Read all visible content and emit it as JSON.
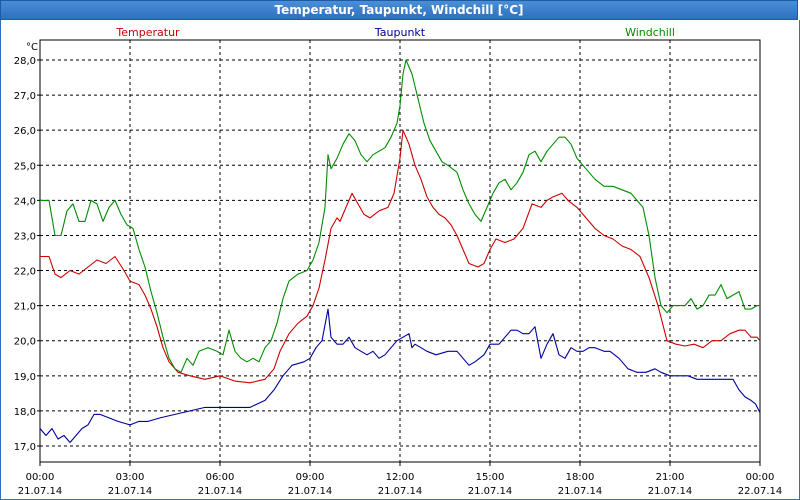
{
  "window": {
    "title": "Temperatur, Taupunkt, Windchill [°C]"
  },
  "chart_data": {
    "type": "line",
    "title": "Temperatur, Taupunkt, Windchill [°C]",
    "ylabel": "°C",
    "ylim": [
      16.6,
      28.5
    ],
    "xlim": [
      0,
      24
    ],
    "yticks": [
      "17,0",
      "18,0",
      "19,0",
      "20,0",
      "21,0",
      "22,0",
      "23,0",
      "24,0",
      "25,0",
      "26,0",
      "27,0",
      "28,0"
    ],
    "ytick_values": [
      17,
      18,
      19,
      20,
      21,
      22,
      23,
      24,
      25,
      26,
      27,
      28
    ],
    "xticks": [
      {
        "time": "00:00",
        "date": "21.07.14"
      },
      {
        "time": "03:00",
        "date": "21.07.14"
      },
      {
        "time": "06:00",
        "date": "21.07.14"
      },
      {
        "time": "09:00",
        "date": "21.07.14"
      },
      {
        "time": "12:00",
        "date": "21.07.14"
      },
      {
        "time": "15:00",
        "date": "21.07.14"
      },
      {
        "time": "18:00",
        "date": "21.07.14"
      },
      {
        "time": "21:00",
        "date": "21.07.14"
      },
      {
        "time": "00:00",
        "date": "22.07.14"
      }
    ],
    "grid": true,
    "series": [
      {
        "name": "Temperatur",
        "color": "#cc0000",
        "points": [
          [
            0,
            22.4
          ],
          [
            0.3,
            22.4
          ],
          [
            0.5,
            21.9
          ],
          [
            0.7,
            21.8
          ],
          [
            1,
            22.0
          ],
          [
            1.3,
            21.9
          ],
          [
            1.6,
            22.1
          ],
          [
            1.9,
            22.3
          ],
          [
            2.2,
            22.2
          ],
          [
            2.5,
            22.4
          ],
          [
            2.8,
            22.0
          ],
          [
            3.0,
            21.7
          ],
          [
            3.3,
            21.6
          ],
          [
            3.5,
            21.3
          ],
          [
            3.7,
            20.9
          ],
          [
            3.9,
            20.4
          ],
          [
            4.1,
            19.8
          ],
          [
            4.3,
            19.4
          ],
          [
            4.6,
            19.1
          ],
          [
            5.0,
            19.0
          ],
          [
            5.5,
            18.9
          ],
          [
            6.0,
            19.0
          ],
          [
            6.5,
            18.85
          ],
          [
            7.0,
            18.8
          ],
          [
            7.5,
            18.9
          ],
          [
            7.8,
            19.2
          ],
          [
            8.0,
            19.7
          ],
          [
            8.3,
            20.2
          ],
          [
            8.6,
            20.5
          ],
          [
            8.9,
            20.7
          ],
          [
            9.1,
            21.0
          ],
          [
            9.3,
            21.5
          ],
          [
            9.5,
            22.3
          ],
          [
            9.7,
            23.2
          ],
          [
            9.9,
            23.5
          ],
          [
            10.0,
            23.4
          ],
          [
            10.2,
            23.8
          ],
          [
            10.4,
            24.2
          ],
          [
            10.6,
            23.9
          ],
          [
            10.8,
            23.6
          ],
          [
            11.0,
            23.5
          ],
          [
            11.3,
            23.7
          ],
          [
            11.6,
            23.8
          ],
          [
            11.8,
            24.2
          ],
          [
            12.0,
            25.2
          ],
          [
            12.1,
            26.0
          ],
          [
            12.3,
            25.6
          ],
          [
            12.5,
            25.0
          ],
          [
            12.7,
            24.6
          ],
          [
            12.9,
            24.1
          ],
          [
            13.1,
            23.8
          ],
          [
            13.3,
            23.6
          ],
          [
            13.5,
            23.5
          ],
          [
            13.7,
            23.3
          ],
          [
            13.9,
            23.0
          ],
          [
            14.1,
            22.6
          ],
          [
            14.3,
            22.2
          ],
          [
            14.6,
            22.1
          ],
          [
            14.8,
            22.2
          ],
          [
            15.0,
            22.6
          ],
          [
            15.2,
            22.9
          ],
          [
            15.5,
            22.8
          ],
          [
            15.8,
            22.9
          ],
          [
            16.1,
            23.2
          ],
          [
            16.4,
            23.9
          ],
          [
            16.7,
            23.8
          ],
          [
            16.9,
            24.0
          ],
          [
            17.1,
            24.1
          ],
          [
            17.4,
            24.2
          ],
          [
            17.6,
            24.0
          ],
          [
            17.9,
            23.8
          ],
          [
            18.2,
            23.5
          ],
          [
            18.5,
            23.2
          ],
          [
            18.8,
            23.0
          ],
          [
            19.1,
            22.9
          ],
          [
            19.4,
            22.7
          ],
          [
            19.7,
            22.6
          ],
          [
            20.0,
            22.4
          ],
          [
            20.3,
            21.8
          ],
          [
            20.6,
            21.0
          ],
          [
            20.9,
            20.0
          ],
          [
            21.2,
            19.9
          ],
          [
            21.5,
            19.85
          ],
          [
            21.8,
            19.9
          ],
          [
            22.1,
            19.8
          ],
          [
            22.4,
            20.0
          ],
          [
            22.7,
            20.0
          ],
          [
            23.0,
            20.2
          ],
          [
            23.3,
            20.3
          ],
          [
            23.5,
            20.3
          ],
          [
            23.7,
            20.1
          ],
          [
            23.9,
            20.1
          ],
          [
            24.0,
            20.0
          ]
        ]
      },
      {
        "name": "Taupunkt",
        "color": "#00009c",
        "points": [
          [
            0,
            17.5
          ],
          [
            0.2,
            17.3
          ],
          [
            0.4,
            17.5
          ],
          [
            0.6,
            17.2
          ],
          [
            0.8,
            17.3
          ],
          [
            1.0,
            17.1
          ],
          [
            1.2,
            17.3
          ],
          [
            1.4,
            17.5
          ],
          [
            1.6,
            17.6
          ],
          [
            1.8,
            17.9
          ],
          [
            2.0,
            17.9
          ],
          [
            2.3,
            17.8
          ],
          [
            2.6,
            17.7
          ],
          [
            3.0,
            17.6
          ],
          [
            3.3,
            17.7
          ],
          [
            3.6,
            17.7
          ],
          [
            4.0,
            17.8
          ],
          [
            4.5,
            17.9
          ],
          [
            5.0,
            18.0
          ],
          [
            5.5,
            18.1
          ],
          [
            6.0,
            18.1
          ],
          [
            6.5,
            18.1
          ],
          [
            7.0,
            18.1
          ],
          [
            7.5,
            18.3
          ],
          [
            7.8,
            18.6
          ],
          [
            8.1,
            19.0
          ],
          [
            8.4,
            19.3
          ],
          [
            8.8,
            19.4
          ],
          [
            9.0,
            19.5
          ],
          [
            9.2,
            19.8
          ],
          [
            9.4,
            20.0
          ],
          [
            9.6,
            20.9
          ],
          [
            9.7,
            20.1
          ],
          [
            9.9,
            19.9
          ],
          [
            10.1,
            19.9
          ],
          [
            10.3,
            20.1
          ],
          [
            10.5,
            19.8
          ],
          [
            10.7,
            19.7
          ],
          [
            10.9,
            19.6
          ],
          [
            11.1,
            19.7
          ],
          [
            11.3,
            19.5
          ],
          [
            11.5,
            19.6
          ],
          [
            11.7,
            19.8
          ],
          [
            11.9,
            20.0
          ],
          [
            12.1,
            20.1
          ],
          [
            12.3,
            20.2
          ],
          [
            12.4,
            19.8
          ],
          [
            12.5,
            19.9
          ],
          [
            12.7,
            19.8
          ],
          [
            12.9,
            19.7
          ],
          [
            13.2,
            19.6
          ],
          [
            13.6,
            19.7
          ],
          [
            13.9,
            19.7
          ],
          [
            14.1,
            19.5
          ],
          [
            14.3,
            19.3
          ],
          [
            14.5,
            19.4
          ],
          [
            14.8,
            19.6
          ],
          [
            15.0,
            19.9
          ],
          [
            15.3,
            19.9
          ],
          [
            15.5,
            20.1
          ],
          [
            15.7,
            20.3
          ],
          [
            15.9,
            20.3
          ],
          [
            16.1,
            20.2
          ],
          [
            16.3,
            20.2
          ],
          [
            16.5,
            20.4
          ],
          [
            16.7,
            19.5
          ],
          [
            16.9,
            19.9
          ],
          [
            17.1,
            20.2
          ],
          [
            17.3,
            19.6
          ],
          [
            17.5,
            19.5
          ],
          [
            17.7,
            19.8
          ],
          [
            17.9,
            19.7
          ],
          [
            18.1,
            19.7
          ],
          [
            18.3,
            19.8
          ],
          [
            18.5,
            19.8
          ],
          [
            18.8,
            19.7
          ],
          [
            19.0,
            19.7
          ],
          [
            19.3,
            19.5
          ],
          [
            19.6,
            19.2
          ],
          [
            19.9,
            19.1
          ],
          [
            20.2,
            19.1
          ],
          [
            20.5,
            19.2
          ],
          [
            20.7,
            19.1
          ],
          [
            21.0,
            19.0
          ],
          [
            21.3,
            19.0
          ],
          [
            21.6,
            19.0
          ],
          [
            21.9,
            18.9
          ],
          [
            22.2,
            18.9
          ],
          [
            22.5,
            18.9
          ],
          [
            22.8,
            18.9
          ],
          [
            23.1,
            18.9
          ],
          [
            23.3,
            18.6
          ],
          [
            23.5,
            18.4
          ],
          [
            23.7,
            18.3
          ],
          [
            23.85,
            18.2
          ],
          [
            24.0,
            17.95
          ]
        ]
      },
      {
        "name": "Windchill",
        "color": "#008c00",
        "points": [
          [
            0,
            24.0
          ],
          [
            0.3,
            24.0
          ],
          [
            0.5,
            23.0
          ],
          [
            0.7,
            23.0
          ],
          [
            0.9,
            23.7
          ],
          [
            1.1,
            23.9
          ],
          [
            1.3,
            23.4
          ],
          [
            1.5,
            23.4
          ],
          [
            1.7,
            24.0
          ],
          [
            1.9,
            23.9
          ],
          [
            2.1,
            23.4
          ],
          [
            2.3,
            23.8
          ],
          [
            2.5,
            24.0
          ],
          [
            2.7,
            23.6
          ],
          [
            2.9,
            23.3
          ],
          [
            3.1,
            23.2
          ],
          [
            3.3,
            22.6
          ],
          [
            3.5,
            22.1
          ],
          [
            3.7,
            21.4
          ],
          [
            3.9,
            20.8
          ],
          [
            4.1,
            20.1
          ],
          [
            4.3,
            19.5
          ],
          [
            4.5,
            19.2
          ],
          [
            4.7,
            19.1
          ],
          [
            4.9,
            19.5
          ],
          [
            5.1,
            19.3
          ],
          [
            5.3,
            19.7
          ],
          [
            5.6,
            19.8
          ],
          [
            5.9,
            19.7
          ],
          [
            6.1,
            19.6
          ],
          [
            6.3,
            20.3
          ],
          [
            6.5,
            19.7
          ],
          [
            6.7,
            19.5
          ],
          [
            6.9,
            19.4
          ],
          [
            7.1,
            19.5
          ],
          [
            7.3,
            19.4
          ],
          [
            7.5,
            19.8
          ],
          [
            7.7,
            20.0
          ],
          [
            7.9,
            20.5
          ],
          [
            8.1,
            21.2
          ],
          [
            8.3,
            21.7
          ],
          [
            8.6,
            21.9
          ],
          [
            8.9,
            22.0
          ],
          [
            9.1,
            22.3
          ],
          [
            9.3,
            22.8
          ],
          [
            9.5,
            23.8
          ],
          [
            9.6,
            25.3
          ],
          [
            9.7,
            24.9
          ],
          [
            9.9,
            25.2
          ],
          [
            10.1,
            25.6
          ],
          [
            10.3,
            25.9
          ],
          [
            10.5,
            25.7
          ],
          [
            10.7,
            25.3
          ],
          [
            10.9,
            25.1
          ],
          [
            11.1,
            25.3
          ],
          [
            11.3,
            25.4
          ],
          [
            11.5,
            25.5
          ],
          [
            11.7,
            25.8
          ],
          [
            11.9,
            26.2
          ],
          [
            12.0,
            26.7
          ],
          [
            12.1,
            27.6
          ],
          [
            12.2,
            28.0
          ],
          [
            12.4,
            27.6
          ],
          [
            12.6,
            26.9
          ],
          [
            12.8,
            26.2
          ],
          [
            13.0,
            25.7
          ],
          [
            13.2,
            25.4
          ],
          [
            13.4,
            25.1
          ],
          [
            13.6,
            25.0
          ],
          [
            13.9,
            24.8
          ],
          [
            14.1,
            24.3
          ],
          [
            14.3,
            23.9
          ],
          [
            14.5,
            23.6
          ],
          [
            14.7,
            23.4
          ],
          [
            14.9,
            23.8
          ],
          [
            15.1,
            24.2
          ],
          [
            15.3,
            24.5
          ],
          [
            15.5,
            24.6
          ],
          [
            15.7,
            24.3
          ],
          [
            15.9,
            24.5
          ],
          [
            16.1,
            24.8
          ],
          [
            16.3,
            25.3
          ],
          [
            16.5,
            25.4
          ],
          [
            16.7,
            25.1
          ],
          [
            16.9,
            25.4
          ],
          [
            17.1,
            25.6
          ],
          [
            17.3,
            25.8
          ],
          [
            17.5,
            25.8
          ],
          [
            17.7,
            25.6
          ],
          [
            17.9,
            25.2
          ],
          [
            18.1,
            25.0
          ],
          [
            18.3,
            24.8
          ],
          [
            18.5,
            24.6
          ],
          [
            18.8,
            24.4
          ],
          [
            19.1,
            24.4
          ],
          [
            19.4,
            24.3
          ],
          [
            19.7,
            24.2
          ],
          [
            19.9,
            24.0
          ],
          [
            20.1,
            23.8
          ],
          [
            20.3,
            23.0
          ],
          [
            20.5,
            21.8
          ],
          [
            20.7,
            21.0
          ],
          [
            20.9,
            20.8
          ],
          [
            21.1,
            21.0
          ],
          [
            21.3,
            21.0
          ],
          [
            21.5,
            21.0
          ],
          [
            21.7,
            21.2
          ],
          [
            21.9,
            20.9
          ],
          [
            22.1,
            21.0
          ],
          [
            22.3,
            21.3
          ],
          [
            22.5,
            21.3
          ],
          [
            22.7,
            21.6
          ],
          [
            22.9,
            21.2
          ],
          [
            23.1,
            21.3
          ],
          [
            23.3,
            21.4
          ],
          [
            23.5,
            20.9
          ],
          [
            23.7,
            20.9
          ],
          [
            23.9,
            21.0
          ],
          [
            24.0,
            21.0
          ]
        ]
      }
    ]
  }
}
